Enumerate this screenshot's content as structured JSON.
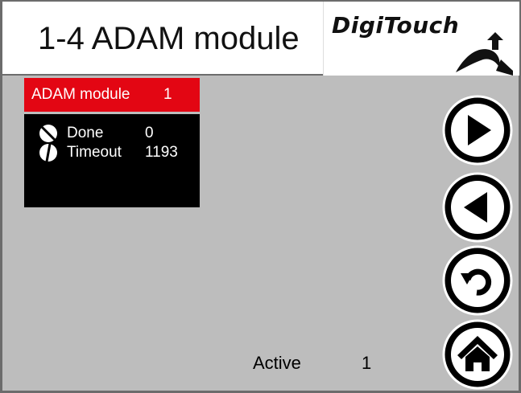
{
  "header": {
    "title": "1-4 ADAM module",
    "logo_text": "DigiTouch"
  },
  "module": {
    "label": "ADAM module",
    "number": "1",
    "accent_color": "#e30613"
  },
  "status": [
    {
      "icon": "done-status-icon",
      "label": "Done",
      "value": "0"
    },
    {
      "icon": "timeout-status-icon",
      "label": "Timeout",
      "value": "1193"
    }
  ],
  "nav": [
    {
      "icon": "play-right-icon"
    },
    {
      "icon": "play-left-icon"
    },
    {
      "icon": "undo-icon"
    },
    {
      "icon": "home-icon"
    }
  ],
  "footer": {
    "active_label": "Active",
    "active_value": "1"
  }
}
